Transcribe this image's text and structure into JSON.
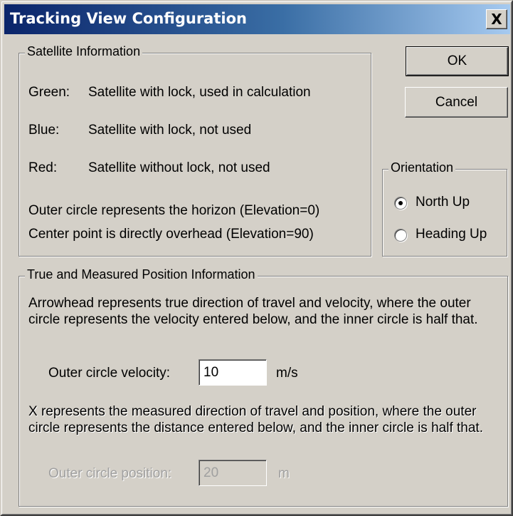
{
  "window": {
    "title": "Tracking View Configuration",
    "close_label": "X"
  },
  "satellite_info": {
    "group_title": "Satellite Information",
    "rows": [
      {
        "label": "Green:",
        "text": "Satellite with lock, used in calculation"
      },
      {
        "label": "Blue:",
        "text": "Satellite with lock, not used"
      },
      {
        "label": "Red:",
        "text": "Satellite without lock, not used"
      }
    ],
    "outer_circle_note": "Outer circle represents the horizon (Elevation=0)",
    "center_point_note": "Center point is directly overhead (Elevation=90)"
  },
  "buttons": {
    "ok_label": "OK",
    "cancel_label": "Cancel"
  },
  "orientation": {
    "group_title": "Orientation",
    "options": [
      {
        "label": "North Up",
        "selected": true
      },
      {
        "label": "Heading Up",
        "selected": false
      }
    ]
  },
  "position_info": {
    "group_title": "True and Measured Position Information",
    "arrowhead_text": "Arrowhead represents true direction of travel and velocity, where the outer circle represents the velocity entered below, and the inner circle is half that.",
    "velocity_label": "Outer circle velocity:",
    "velocity_value": "10",
    "velocity_unit": "m/s",
    "x_text": "X represents the measured direction of travel and position, where the outer circle represents the distance entered below, and the inner circle is half that.",
    "position_label": "Outer circle position:",
    "position_value": "20",
    "position_unit": "m"
  }
}
